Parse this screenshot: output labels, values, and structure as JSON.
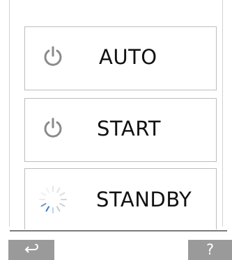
{
  "modes": {
    "auto": {
      "label": "AUTO",
      "icon": "power-icon"
    },
    "start": {
      "label": "START",
      "icon": "power-icon"
    },
    "standby": {
      "label": "STANDBY",
      "icon": "loading-spinner-icon"
    }
  },
  "footer": {
    "back_icon": "back-arrow-icon",
    "help_label": "?"
  },
  "colors": {
    "icon_gray": "#8a8a8a",
    "button_gray": "#9a9a9a",
    "spinner_blue": "#3a78c8"
  }
}
